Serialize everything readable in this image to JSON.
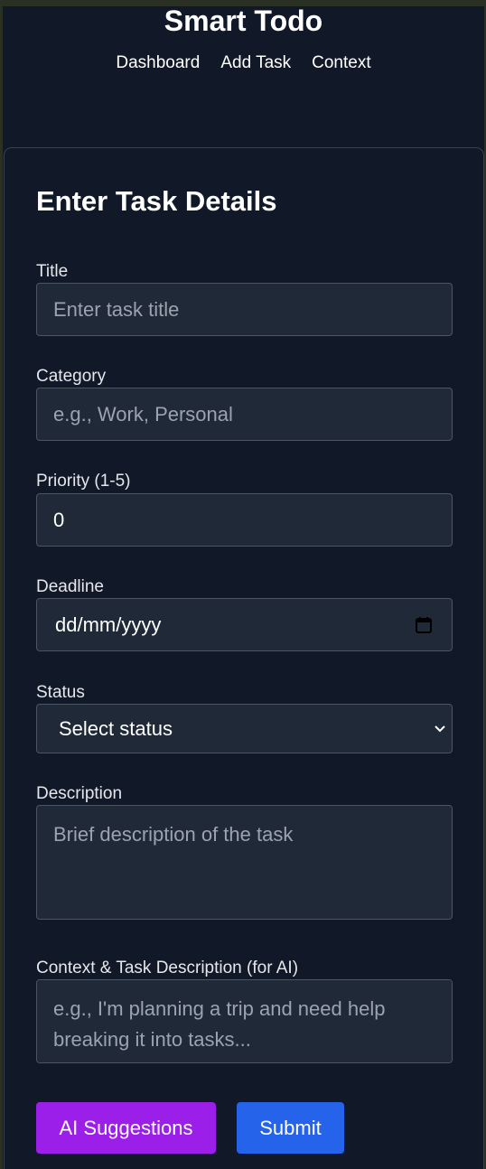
{
  "header": {
    "title": "Smart Todo",
    "nav": [
      "Dashboard",
      "Add Task",
      "Context"
    ]
  },
  "form": {
    "heading": "Enter Task Details",
    "title": {
      "label": "Title",
      "placeholder": "Enter task title",
      "value": ""
    },
    "category": {
      "label": "Category",
      "placeholder": "e.g., Work, Personal",
      "value": ""
    },
    "priority": {
      "label": "Priority (1-5)",
      "value": "0"
    },
    "deadline": {
      "label": "Deadline",
      "value": "dd/mm/yyyy",
      "icon": "calendar-icon"
    },
    "status": {
      "label": "Status",
      "selected": "Select status",
      "icon": "chevron-down-icon"
    },
    "description": {
      "label": "Description",
      "placeholder": "Brief description of the task"
    },
    "context": {
      "label": "Context & Task Description (for AI)",
      "placeholder": "e.g., I'm planning a trip and need help breaking it into tasks..."
    },
    "buttons": {
      "ai": "AI Suggestions",
      "submit": "Submit"
    }
  },
  "colors": {
    "background": "#111827",
    "field": "#1f2937",
    "ai_button": "#9b1fe8",
    "submit_button": "#2563eb"
  }
}
